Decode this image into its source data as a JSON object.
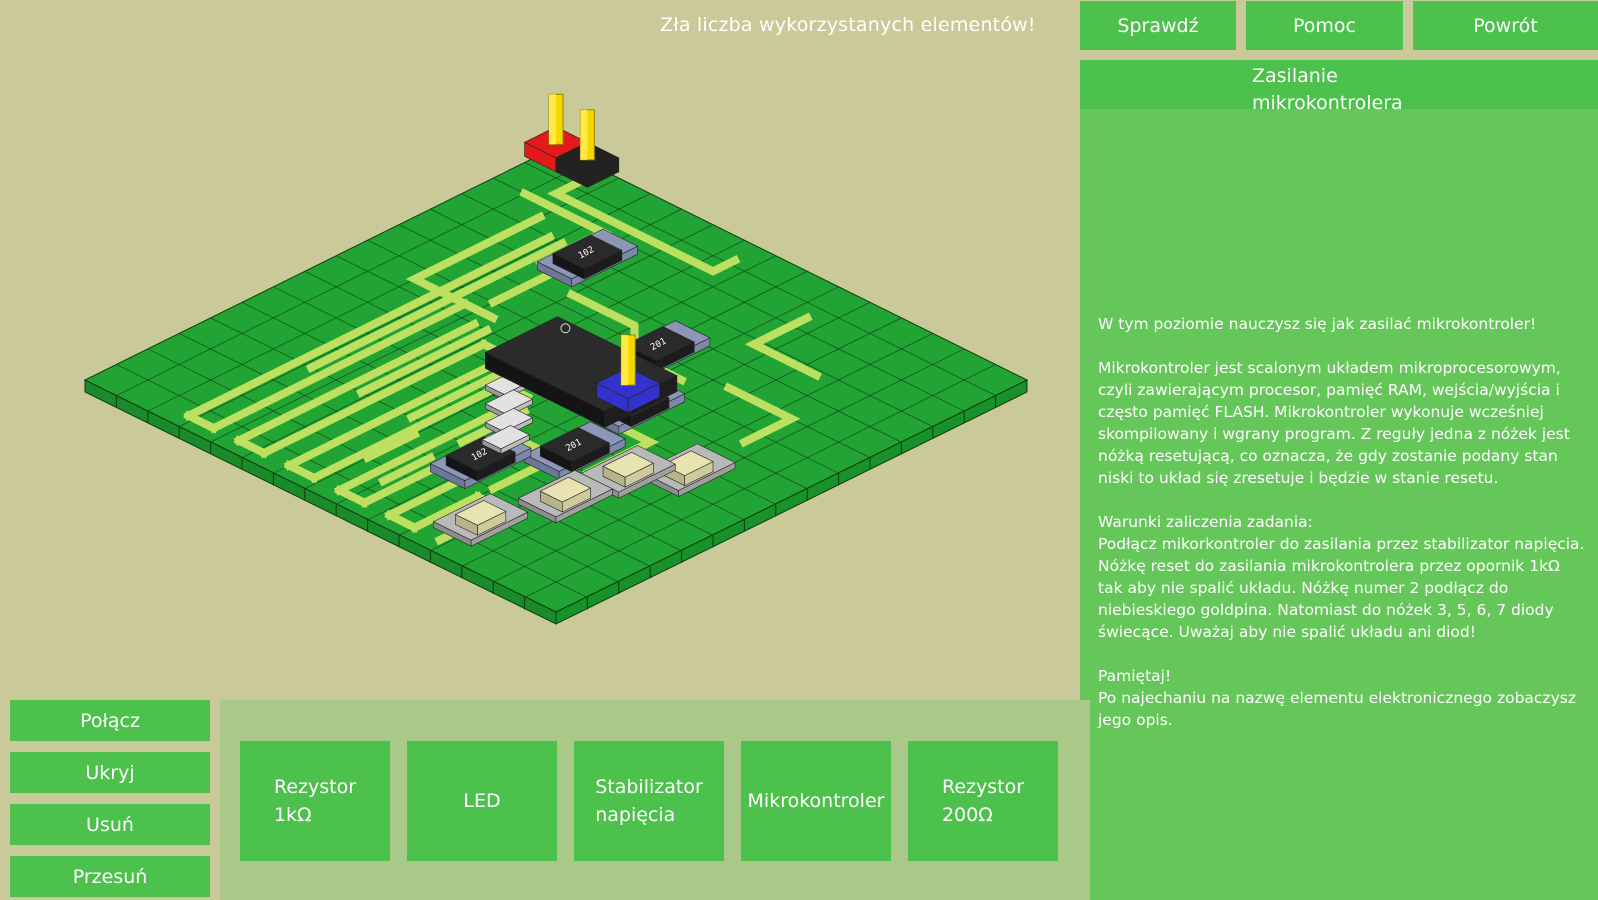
{
  "status": "Zła liczba wykorzystanych elementów!",
  "header": {
    "check": "Sprawdź",
    "help": "Pomoc",
    "back": "Powrót"
  },
  "panel": {
    "title": "Zasilanie mikrokontrolera",
    "intro": "W tym poziomie nauczysz się jak zasilać mikrokontroler!",
    "description": "Mikrokontroler jest scalonym układem mikroprocesorowym, czyli zawierającym procesor, pamięć RAM, wejścia/wyjścia i często pamięć FLASH. Mikrokontroler wykonuje wcześniej skompilowany i wgrany program. Z reguły jedna z nóżek jest nóżką resetującą, co oznacza, że gdy zostanie podany stan niski to układ się zresetuje i będzie w stanie resetu.",
    "conditions_heading": "Warunki zaliczenia zadania:",
    "conditions": "Podłącz mikorkontroler do zasilania przez stabilizator napięcia. Nóżkę reset do zasilania mikrokontrolera przez opornik 1kΩ tak aby nie spalić układu. Nóżkę numer 2 podłącz do niebieskiego goldpina. Natomiast do nóżek 3, 5, 6, 7 diody świecące. Uważaj aby nie spalić układu ani diod!",
    "remember_heading": "Pamiętaj!",
    "remember": "Po najechaniu na nazwę elementu elektronicznego zobaczysz jego opis."
  },
  "tools": {
    "connect": "Połącz",
    "hide": "Ukryj",
    "remove": "Usuń",
    "move": "Przesuń"
  },
  "parts": {
    "resistor_1k_line1": "Rezystor",
    "resistor_1k_line2": "1kΩ",
    "led": "LED",
    "regulator_line1": "Stabilizator",
    "regulator_line2": "napięcia",
    "mcu": "Mikrokontroler",
    "resistor_200_line1": "Rezystor",
    "resistor_200_line2": "200Ω"
  },
  "board": {
    "resistor_marking_1": "201",
    "resistor_marking_2": "102",
    "colors": {
      "board": "#22a434",
      "trace": "#bde060",
      "pin_red": "#e31a1a",
      "pin_black": "#222222",
      "pin_blue": "#3333cc",
      "pin_gold": "#f5d800"
    }
  }
}
